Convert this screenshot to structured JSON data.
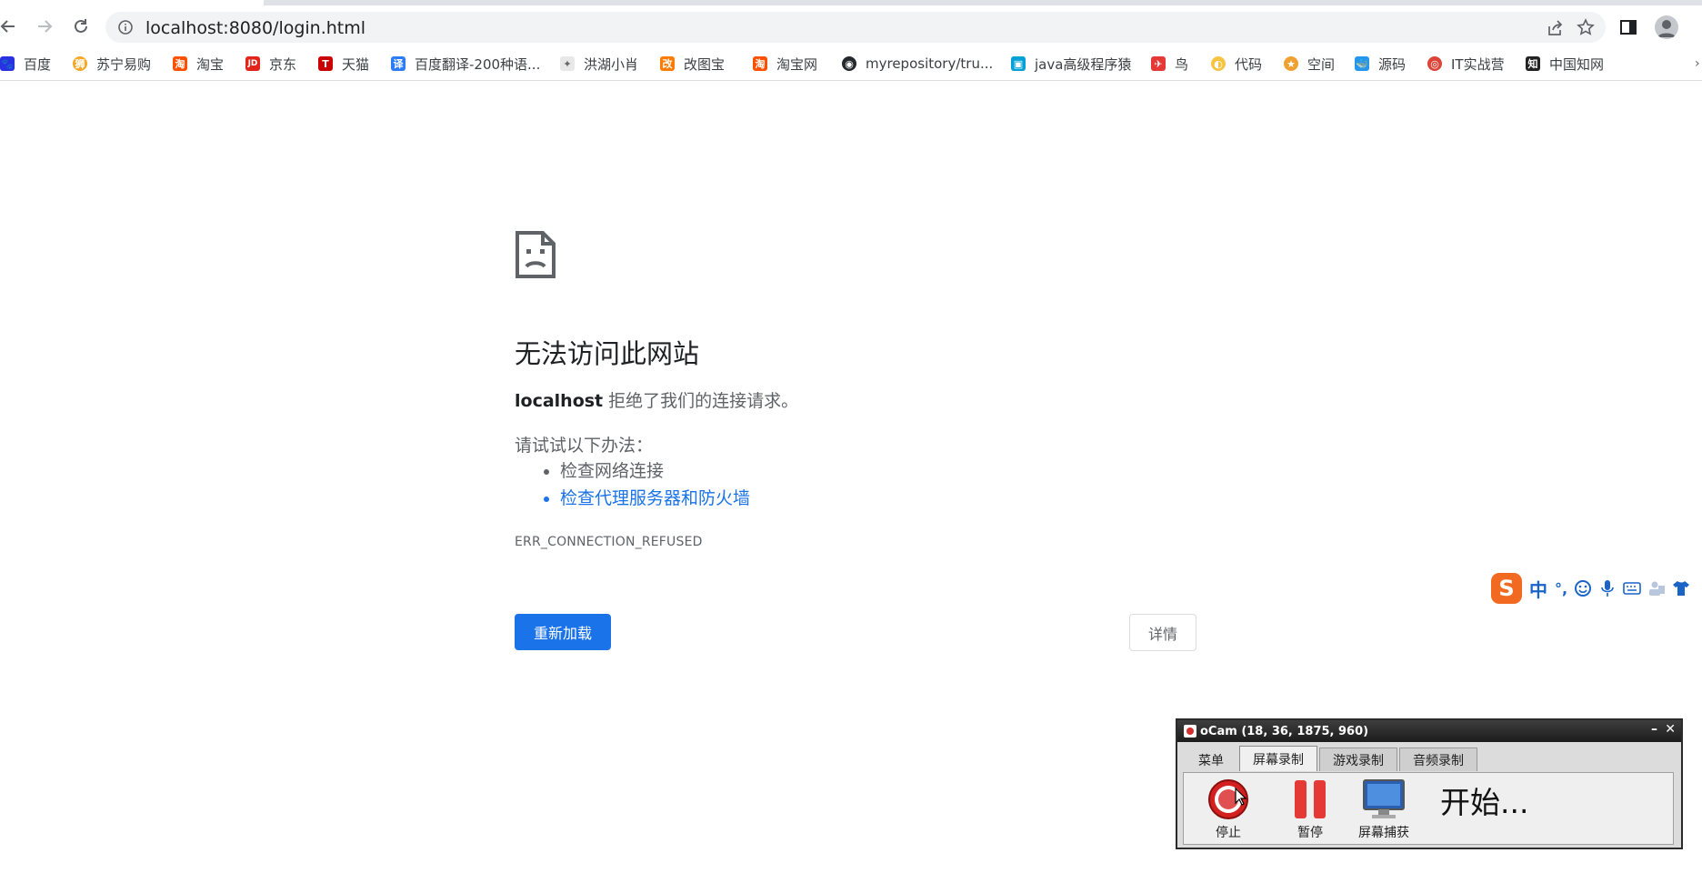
{
  "browser": {
    "url": "localhost:8080/login.html",
    "bookmarks": [
      {
        "label": "百度",
        "icon": "baidu-paw-icon",
        "color": "#2932e1"
      },
      {
        "label": "苏宁易购",
        "icon": "suning-lion-icon",
        "color": "#f5a623"
      },
      {
        "label": "淘宝",
        "icon": "taobao-icon",
        "color": "#ff5000"
      },
      {
        "label": "京东",
        "icon": "jd-icon",
        "color": "#e1251b"
      },
      {
        "label": "天猫",
        "icon": "tmall-icon",
        "color": "#cc0000"
      },
      {
        "label": "百度翻译-200种语...",
        "icon": "baidu-translate-icon",
        "color": "#2c7cf6"
      },
      {
        "label": "洪湖小肖",
        "icon": "bird-icon",
        "color": "#666666"
      },
      {
        "label": "改图宝",
        "icon": "gaitubao-icon",
        "color": "#ff7a00"
      },
      {
        "label": "淘宝网",
        "icon": "taobao-icon",
        "color": "#ff5000"
      },
      {
        "label": "myrepository/tru...",
        "icon": "github-icon",
        "color": "#24292e"
      },
      {
        "label": "java高级程序猿",
        "icon": "bilibili-icon",
        "color": "#00a1d6"
      },
      {
        "label": "鸟",
        "icon": "bird-icon",
        "color": "#e53935"
      },
      {
        "label": "代码",
        "icon": "code-icon",
        "color": "#f6c343"
      },
      {
        "label": "空间",
        "icon": "qzone-icon",
        "color": "#f0a030"
      },
      {
        "label": "源码",
        "icon": "docker-whale-icon",
        "color": "#2496ed"
      },
      {
        "label": "IT实战营",
        "icon": "chrome-icon",
        "color": "#db4437"
      },
      {
        "label": "中国知网",
        "icon": "cnki-icon",
        "color": "#222222"
      }
    ]
  },
  "error_page": {
    "title": "无法访问此网站",
    "host": "localhost",
    "summary_rest": " 拒绝了我们的连接请求。",
    "try_label": "请试试以下办法：",
    "suggestions": [
      "检查网络连接",
      "检查代理服务器和防火墙"
    ],
    "error_code": "ERR_CONNECTION_REFUSED",
    "reload_label": "重新加载",
    "details_label": "详情"
  },
  "ime": {
    "logo": "S",
    "mode": "中",
    "punct": "°,"
  },
  "ocam": {
    "title": "oCam (18, 36, 1875, 960)",
    "tabs": [
      "菜单",
      "屏幕录制",
      "游戏录制",
      "音频录制"
    ],
    "active_tab": "屏幕录制",
    "stop_label": "停止",
    "pause_label": "暂停",
    "capture_label": "屏幕捕获",
    "status": "开始..."
  }
}
